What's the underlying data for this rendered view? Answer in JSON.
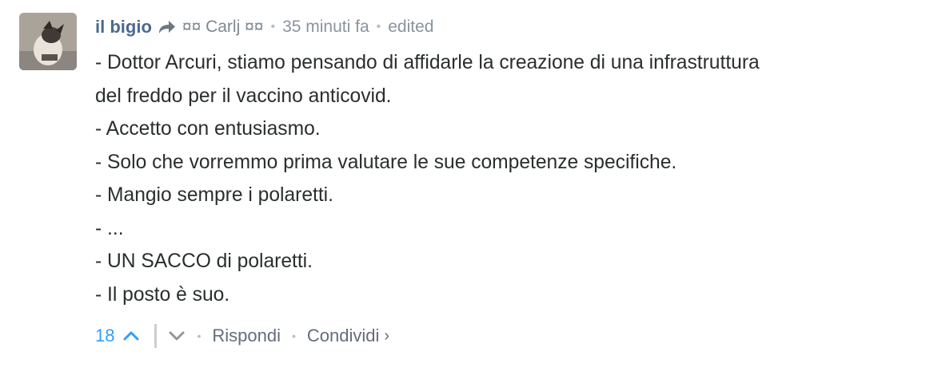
{
  "comment": {
    "author": "il bigio",
    "reply_to": "¤¤ Carlj ¤¤",
    "time": "35 minuti fa",
    "edited": "edited",
    "lines": [
      "- Dottor Arcuri, stiamo pensando di affidarle la creazione di una infrastruttura",
      "del freddo per il vaccino anticovid.",
      "- Accetto con entusiasmo.",
      "- Solo che vorremmo prima valutare le sue competenze specifiche.",
      "- Mangio sempre i polaretti.",
      "- ...",
      "- UN SACCO di polaretti.",
      "- Il posto è suo."
    ]
  },
  "footer": {
    "vote_count": "18",
    "reply_label": "Rispondi",
    "share_label": "Condividi",
    "share_chevron": "›"
  },
  "icons": {
    "reply_arrow": "reply-arrow-icon",
    "upvote": "chevron-up-icon",
    "downvote": "chevron-down-icon"
  },
  "colors": {
    "author": "#4a6a8f",
    "vote_count": "#2e9fff",
    "text": "#2a2e2e",
    "meta": "#8a949e"
  }
}
